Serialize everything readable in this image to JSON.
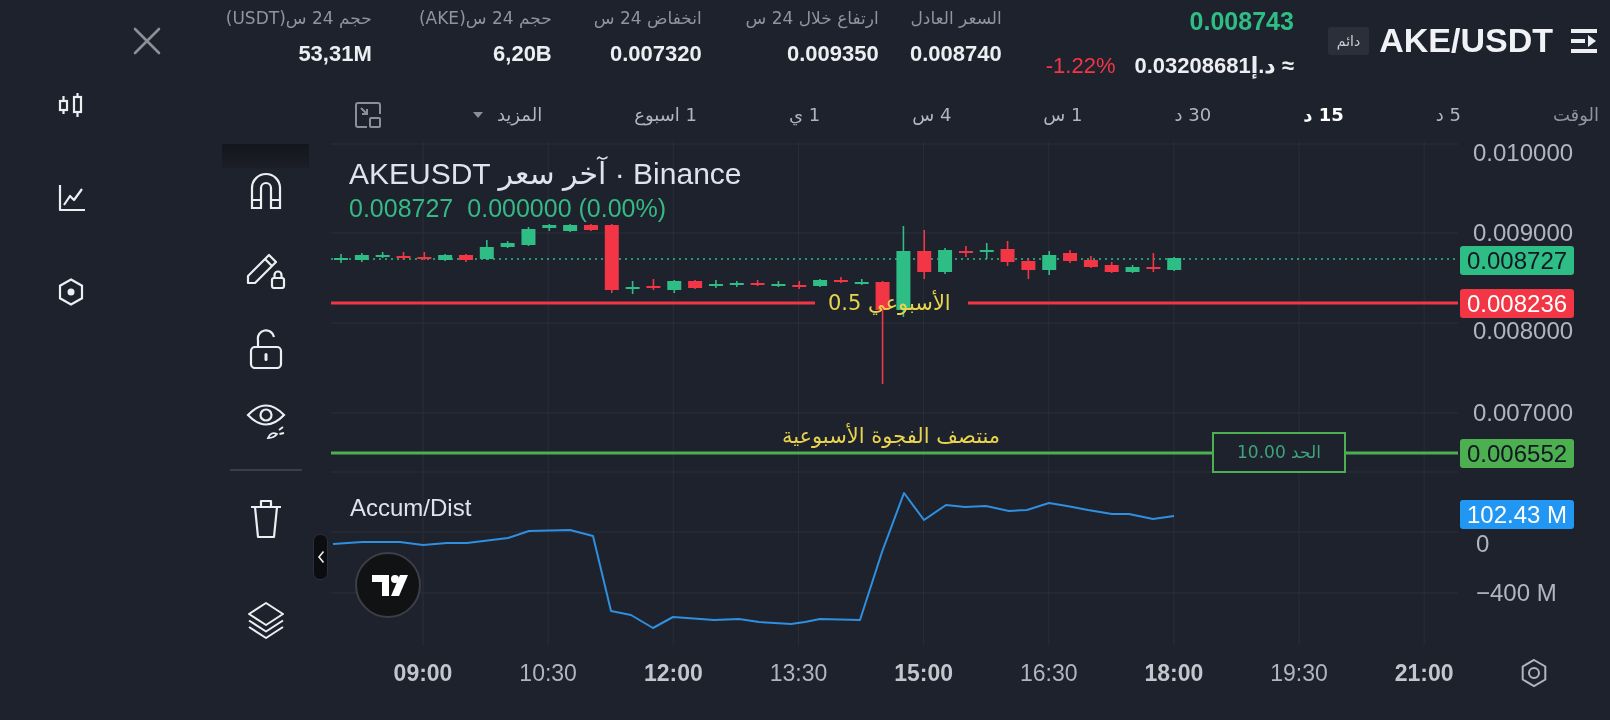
{
  "header": {
    "symbol": "AKE/USDT",
    "contract_badge": "دائم",
    "last_price": "0.008743",
    "fiat_price": "≈ د.إ0.03208681",
    "change": {
      "text": "-1.22%",
      "negative": true
    },
    "stats": [
      {
        "label": "السعر العادل",
        "value": "0.008740"
      },
      {
        "label": "ارتفاع خلال 24 س",
        "value": "0.009350"
      },
      {
        "label": "انخفاض 24 س",
        "value": "0.007320"
      },
      {
        "label": "حجم 24 س(AKE)",
        "value": "6,20B"
      },
      {
        "label": "حجم 24 س(USDT)",
        "value": "53,31M"
      }
    ]
  },
  "timeframes": {
    "label": "الوقت",
    "items": [
      {
        "label": "5 د",
        "selected": false
      },
      {
        "label": "15 د",
        "selected": true
      },
      {
        "label": "30 د",
        "selected": false
      },
      {
        "label": "1 س",
        "selected": false
      },
      {
        "label": "4 س",
        "selected": false
      },
      {
        "label": "1 ي",
        "selected": false
      },
      {
        "label": "1 اسبوع",
        "selected": false
      }
    ],
    "more": "المزيد"
  },
  "chart": {
    "legend": {
      "title": "AKEUSDT آخر سعر · Binance",
      "close": "0.008727",
      "change": "0.000000 (0.00%)"
    },
    "current_price": "0.008727",
    "price_ticks": [
      "0.010000",
      "0.009000",
      "0.008000",
      "0.007000"
    ],
    "drawings": [
      {
        "label": "الأسبوعي 0.5",
        "price": "0.008236",
        "color": "#f23645"
      },
      {
        "label": "منتصف الفجوة الأسبوعية",
        "price": "0.006552",
        "color": "#4caf50",
        "alert": "الحد 10.00"
      }
    ],
    "indicator": {
      "name": "Accum/Dist",
      "value": "102.43 M",
      "ticks": [
        "0",
        "−400 M"
      ]
    },
    "time_ticks": [
      {
        "label": "21:00",
        "major": true
      },
      {
        "label": "19:30",
        "major": false
      },
      {
        "label": "18:00",
        "major": true
      },
      {
        "label": "16:30",
        "major": false
      },
      {
        "label": "15:00",
        "major": true
      },
      {
        "label": "13:30",
        "major": false
      },
      {
        "label": "12:00",
        "major": true
      },
      {
        "label": "10:30",
        "major": false
      },
      {
        "label": "09:00",
        "major": true
      }
    ]
  }
}
